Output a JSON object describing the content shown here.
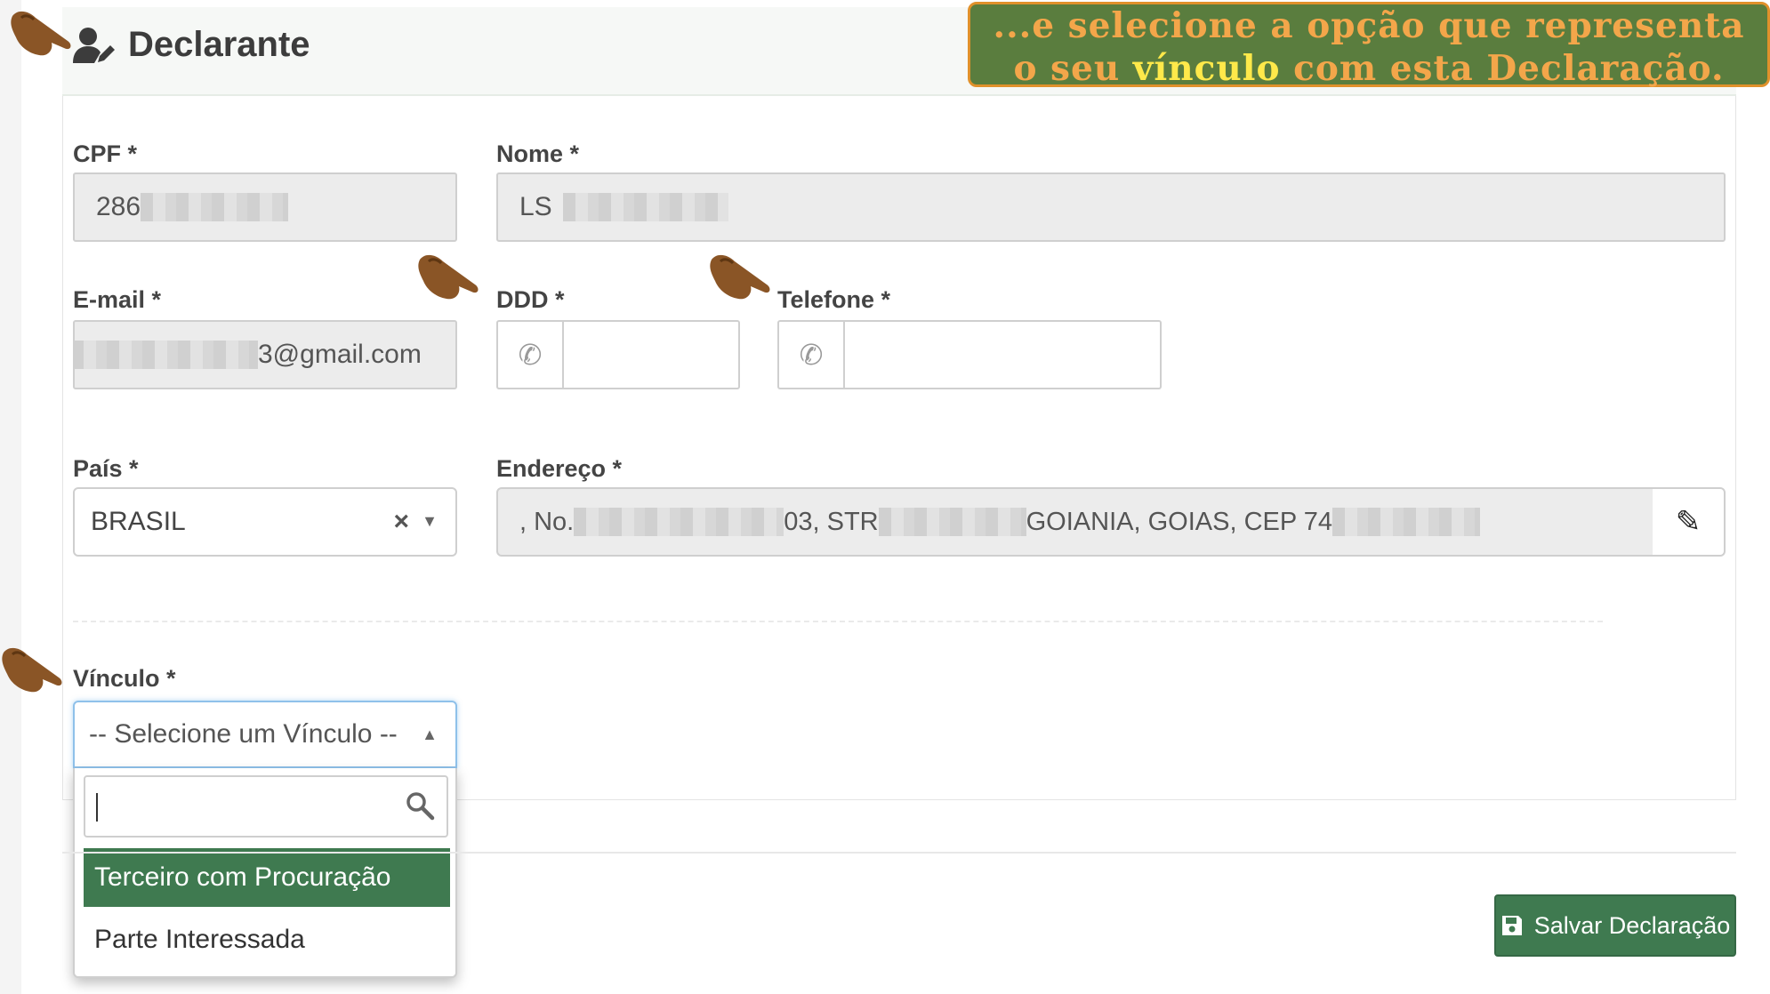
{
  "callout": {
    "line1": "...e selecione a opção que representa",
    "line2_pre": "o seu ",
    "line2_highlight": "vínculo",
    "line2_post": " com esta Declaração."
  },
  "panel": {
    "title": "Declarante",
    "title_icon": "user-edit-icon",
    "collapse_icon": "chevron-up-icon"
  },
  "fields": {
    "cpf": {
      "label": "CPF *",
      "value_prefix": "286"
    },
    "nome": {
      "label": "Nome *",
      "value_prefix": "LS"
    },
    "email": {
      "label": "E-mail *",
      "value_suffix": "3@gmail.com"
    },
    "ddd": {
      "label": "DDD *",
      "icon": "phone-icon",
      "value": ""
    },
    "telefone": {
      "label": "Telefone *",
      "icon": "phone-icon",
      "value": ""
    },
    "pais": {
      "label": "País *",
      "value": "BRASIL",
      "clear": "×",
      "caret": "▼"
    },
    "endereco": {
      "label": "Endereço *",
      "part1": ", No.",
      "part2": "03, STR",
      "part3": "GOIANIA, GOIAS, CEP 74",
      "edit_icon": "pencil-icon"
    },
    "vinculo": {
      "label": "Vínculo *",
      "placeholder": "-- Selecione um Vínculo --",
      "caret": "▲",
      "search_value": "",
      "options": [
        "Terceiro com Procuração",
        "Parte Interessada"
      ],
      "highlighted_index": 0
    }
  },
  "footer": {
    "save_label": "Salvar Declaração",
    "save_icon": "floppy-disk-icon"
  },
  "colors": {
    "accent_green": "#3f7a50",
    "callout_bg": "#5a7d3e",
    "callout_text": "#f3a64a",
    "callout_highlight": "#ffe94a",
    "callout_border": "#e0912b"
  }
}
